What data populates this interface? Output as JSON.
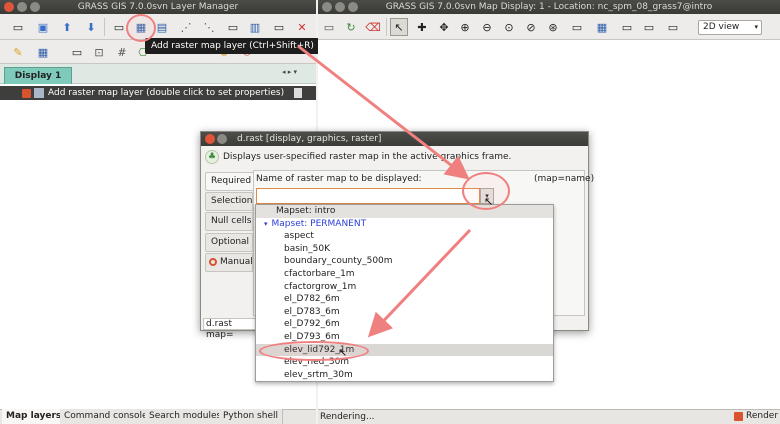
{
  "layer_manager": {
    "title": "GRASS GIS 7.0.0svn Layer Manager",
    "tooltip": "Add raster map layer (Ctrl+Shift+R)",
    "display_tab": "Display 1",
    "layer_item": "Add raster map layer (double click to set properties)",
    "bottom_tabs": [
      "Map layers",
      "Command console",
      "Search modules",
      "Python shell"
    ]
  },
  "map_display": {
    "title": "GRASS GIS 7.0.0svn Map Display: 1  - Location: nc_spm_08_grass7@intro",
    "view_select": "2D view",
    "status": "Rendering...",
    "render_label": "Render"
  },
  "dialog": {
    "title": "d.rast [display, graphics, raster]",
    "description": "Displays user-specified raster map in the active graphics frame.",
    "tabs": [
      "Required",
      "Selection",
      "Null cells",
      "Optional",
      "Manual"
    ],
    "field_label": "Name of raster map to be displayed:",
    "field_hint": "(map=name)",
    "field_value": "",
    "cmd_prefix": "d.rast map="
  },
  "dropdown": {
    "mapset_intro": "Mapset: intro",
    "mapset_permanent": "Mapset: PERMANENT",
    "items": [
      "aspect",
      "basin_50K",
      "boundary_county_500m",
      "cfactorbare_1m",
      "cfactorgrow_1m",
      "el_D782_6m",
      "el_D783_6m",
      "el_D792_6m",
      "el_D793_6m",
      "elev_lid792_1m",
      "elev_ned_30m",
      "elev_srtm_30m"
    ],
    "highlighted_index": 9
  },
  "colors": {
    "accent": "#f08080",
    "permanent_mapset": "#2b3fd6",
    "highlight": "#d9d8d5"
  },
  "icons": [
    "new-display-icon",
    "add-raster-icon",
    "add-vector-icon",
    "zoom-in-icon",
    "zoom-out-icon",
    "pan-icon",
    "pointer-icon",
    "render-icon",
    "grass-icon",
    "layer-checkbox-icon"
  ]
}
